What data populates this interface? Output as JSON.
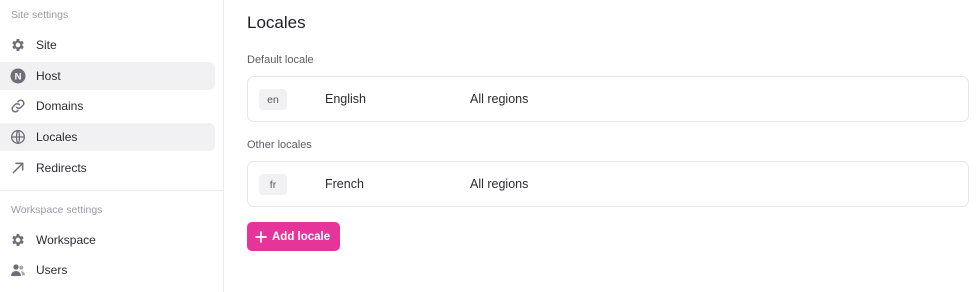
{
  "sidebar": {
    "site_settings_label": "Site settings",
    "site_items": [
      {
        "label": "Site",
        "icon": "gear-icon"
      },
      {
        "label": "Host",
        "icon": "host-icon"
      },
      {
        "label": "Domains",
        "icon": "link-icon"
      },
      {
        "label": "Locales",
        "icon": "globe-icon"
      },
      {
        "label": "Redirects",
        "icon": "arrow-up-right-icon"
      }
    ],
    "workspace_settings_label": "Workspace settings",
    "workspace_items": [
      {
        "label": "Workspace",
        "icon": "gear-icon"
      },
      {
        "label": "Users",
        "icon": "users-icon"
      }
    ],
    "host_badge_letter": "N"
  },
  "main": {
    "title": "Locales",
    "default_label": "Default locale",
    "default_locale": {
      "code": "en",
      "name": "English",
      "region": "All regions"
    },
    "other_label": "Other locales",
    "other_locales": [
      {
        "code": "fr",
        "name": "French",
        "region": "All regions"
      }
    ],
    "add_button_label": "Add locale"
  },
  "colors": {
    "accent": "#e7349a",
    "active_bg": "#f1f1f3",
    "border": "#e6e6ea"
  }
}
